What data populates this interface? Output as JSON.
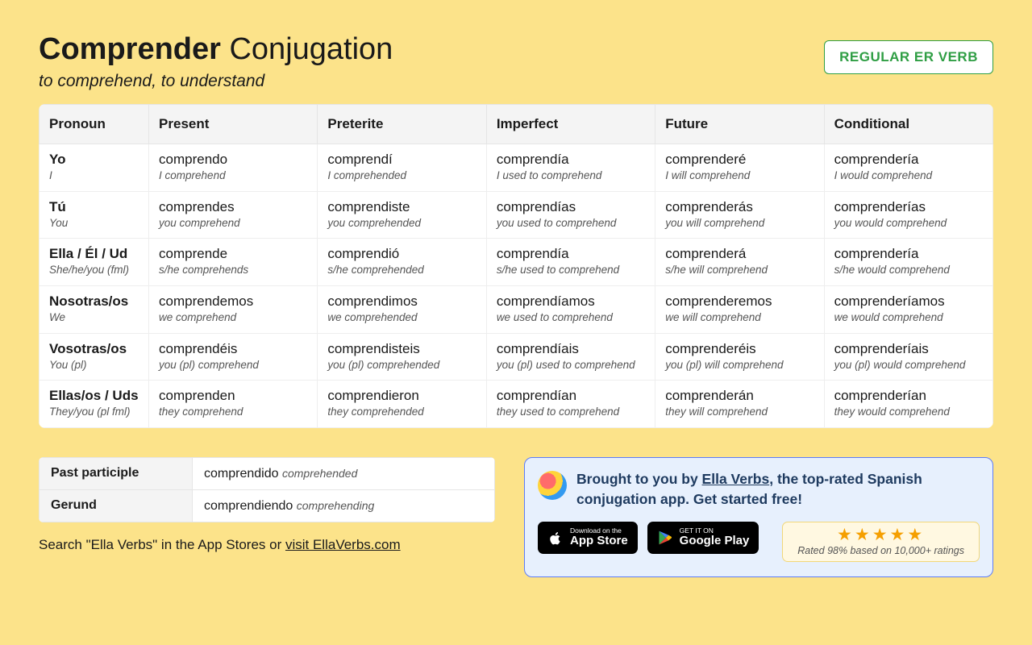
{
  "header": {
    "verb": "Comprender",
    "title_rest": "Conjugation",
    "translation": "to comprehend, to understand",
    "badge": "REGULAR ER VERB"
  },
  "columns": [
    "Pronoun",
    "Present",
    "Preterite",
    "Imperfect",
    "Future",
    "Conditional"
  ],
  "rows": [
    {
      "pronoun": {
        "es": "Yo",
        "en": "I"
      },
      "cells": [
        {
          "es": "comprendo",
          "en": "I comprehend"
        },
        {
          "es": "comprendí",
          "en": "I comprehended"
        },
        {
          "es": "comprendía",
          "en": "I used to comprehend"
        },
        {
          "es": "comprenderé",
          "en": "I will comprehend"
        },
        {
          "es": "comprendería",
          "en": "I would comprehend"
        }
      ]
    },
    {
      "pronoun": {
        "es": "Tú",
        "en": "You"
      },
      "cells": [
        {
          "es": "comprendes",
          "en": "you comprehend"
        },
        {
          "es": "comprendiste",
          "en": "you comprehended"
        },
        {
          "es": "comprendías",
          "en": "you used to comprehend"
        },
        {
          "es": "comprenderás",
          "en": "you will comprehend"
        },
        {
          "es": "comprenderías",
          "en": "you would comprehend"
        }
      ]
    },
    {
      "pronoun": {
        "es": "Ella / Él / Ud",
        "en": "She/he/you (fml)"
      },
      "cells": [
        {
          "es": "comprende",
          "en": "s/he comprehends"
        },
        {
          "es": "comprendió",
          "en": "s/he comprehended"
        },
        {
          "es": "comprendía",
          "en": "s/he used to comprehend"
        },
        {
          "es": "comprenderá",
          "en": "s/he will comprehend"
        },
        {
          "es": "comprendería",
          "en": "s/he would comprehend"
        }
      ]
    },
    {
      "pronoun": {
        "es": "Nosotras/os",
        "en": "We"
      },
      "cells": [
        {
          "es": "comprendemos",
          "en": "we comprehend"
        },
        {
          "es": "comprendimos",
          "en": "we comprehended"
        },
        {
          "es": "comprendíamos",
          "en": "we used to comprehend"
        },
        {
          "es": "comprenderemos",
          "en": "we will comprehend"
        },
        {
          "es": "comprenderíamos",
          "en": "we would comprehend"
        }
      ]
    },
    {
      "pronoun": {
        "es": "Vosotras/os",
        "en": "You (pl)"
      },
      "cells": [
        {
          "es": "comprendéis",
          "en": "you (pl) comprehend"
        },
        {
          "es": "comprendisteis",
          "en": "you (pl) comprehended"
        },
        {
          "es": "comprendíais",
          "en": "you (pl) used to comprehend"
        },
        {
          "es": "comprenderéis",
          "en": "you (pl) will comprehend"
        },
        {
          "es": "comprenderíais",
          "en": "you (pl) would comprehend"
        }
      ]
    },
    {
      "pronoun": {
        "es": "Ellas/os / Uds",
        "en": "They/you (pl fml)"
      },
      "cells": [
        {
          "es": "comprenden",
          "en": "they comprehend"
        },
        {
          "es": "comprendieron",
          "en": "they comprehended"
        },
        {
          "es": "comprendían",
          "en": "they used to comprehend"
        },
        {
          "es": "comprenderán",
          "en": "they will comprehend"
        },
        {
          "es": "comprenderían",
          "en": "they would comprehend"
        }
      ]
    }
  ],
  "participles": [
    {
      "label": "Past participle",
      "es": "comprendido",
      "en": "comprehended"
    },
    {
      "label": "Gerund",
      "es": "comprendiendo",
      "en": "comprehending"
    }
  ],
  "search": {
    "prefix": "Search \"Ella Verbs\" in the App Stores or ",
    "link": "visit EllaVerbs.com"
  },
  "promo": {
    "text_before": "Brought to you by ",
    "link": "Ella Verbs",
    "text_after": ", the top-rated Spanish conjugation app. Get started free!",
    "appstore": {
      "small": "Download on the",
      "big": "App Store"
    },
    "play": {
      "small": "GET IT ON",
      "big": "Google Play"
    },
    "stars": "★★★★★",
    "rating_text": "Rated 98% based on 10,000+ ratings"
  }
}
